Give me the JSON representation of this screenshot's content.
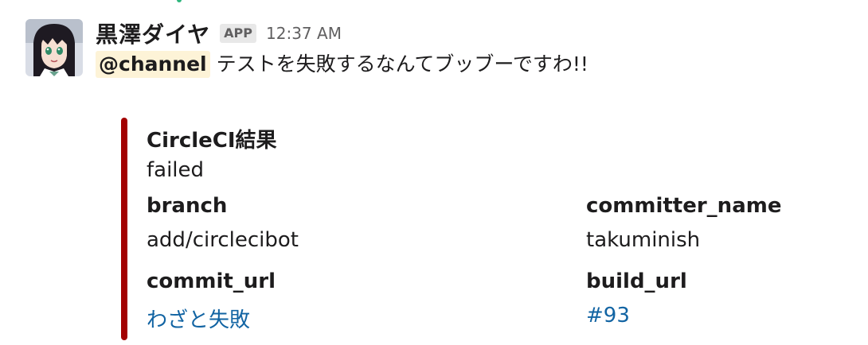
{
  "message": {
    "sender": "黒澤ダイヤ",
    "badge": "APP",
    "time": "12:37 AM",
    "mention": "@channel",
    "text": "テストを失敗するなんてブッブーですわ!!"
  },
  "attachment": {
    "bar_color": "#a30000",
    "title": "CircleCI結果",
    "status": "failed",
    "fields": {
      "branch_title": "branch",
      "branch_value": "add/circlecibot",
      "committer_title": "committer_name",
      "committer_value": "takuminish",
      "commit_url_title": "commit_url",
      "commit_url_value": "わざと失敗",
      "build_url_title": "build_url",
      "build_url_value": "#93"
    }
  },
  "colors": {
    "link": "#1264a3",
    "mention_bg": "#fdf3d7"
  }
}
